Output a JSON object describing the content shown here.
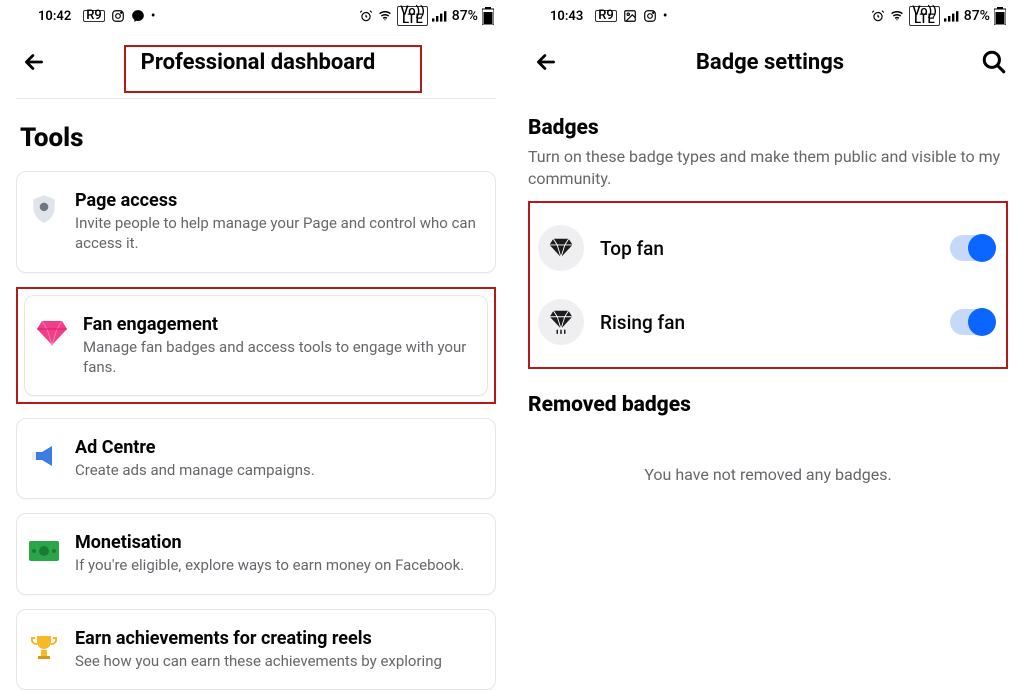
{
  "left": {
    "status": {
      "time": "10:42",
      "battery": "87%"
    },
    "title": "Professional dashboard",
    "section_title": "Tools",
    "tools": [
      {
        "title": "Page access",
        "sub": "Invite people to help manage your Page and control who can access it."
      },
      {
        "title": "Fan engagement",
        "sub": "Manage fan badges and access tools to engage with your fans."
      },
      {
        "title": "Ad Centre",
        "sub": "Create ads and manage campaigns."
      },
      {
        "title": "Monetisation",
        "sub": "If you're eligible, explore ways to earn money on Facebook."
      },
      {
        "title": "Earn achievements for creating reels",
        "sub": "See how you can earn these achievements by exploring"
      }
    ]
  },
  "right": {
    "status": {
      "time": "10:43",
      "battery": "87%"
    },
    "title": "Badge settings",
    "badges_heading": "Badges",
    "badges_desc": "Turn on these badge types and make them public and visible to my community.",
    "badges": [
      {
        "label": "Top fan"
      },
      {
        "label": "Rising fan"
      }
    ],
    "removed_heading": "Removed badges",
    "removed_empty": "You have not removed any badges."
  }
}
